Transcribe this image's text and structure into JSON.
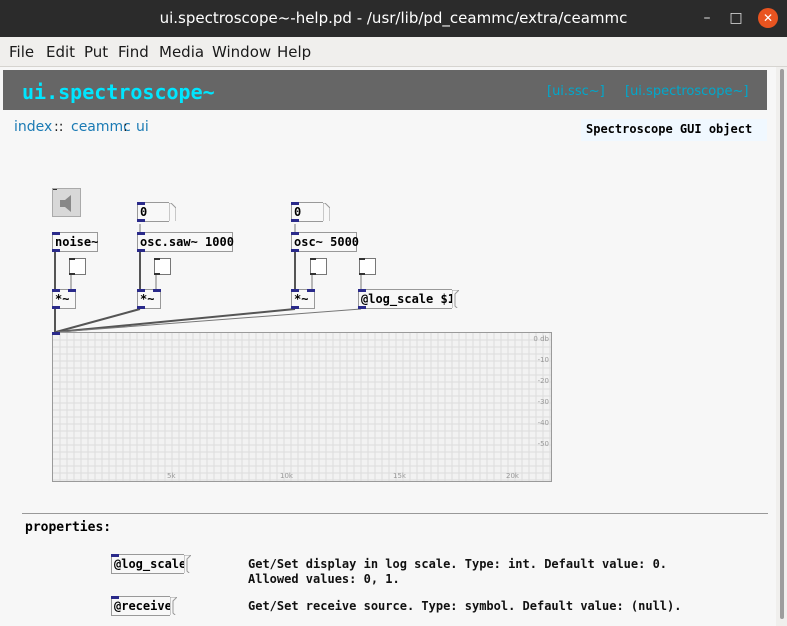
{
  "window": {
    "title": "ui.spectroscope~-help.pd  - /usr/lib/pd_ceammc/extra/ceammc",
    "minimize": "–",
    "maximize": "□",
    "close": "✕"
  },
  "menu": {
    "file": "File",
    "edit": "Edit",
    "put": "Put",
    "find": "Find",
    "media": "Media",
    "window": "Window",
    "help": "Help"
  },
  "header": {
    "title": "ui.spectroscope~",
    "link1": "[ui.ssc~]",
    "link2": "[ui.spectroscope~]",
    "title_color": "#00e6ff",
    "bg_color": "#666666"
  },
  "breadcrumb": {
    "index": "index",
    "sep1": "::",
    "ceammc": "ceammc",
    "sep2": ":",
    "ui": "ui"
  },
  "description": "Spectroscope GUI object",
  "objects": {
    "num1": "0",
    "num2": "0",
    "noise": "noise~",
    "osc_saw": "osc.saw~ 1000",
    "osc": "osc~ 5000",
    "mul1": "*~",
    "mul2": "*~",
    "mul3": "*~",
    "log_scale_msg": "@log_scale $1"
  },
  "spectroscope": {
    "db_labels": [
      "0 db",
      "-10",
      "-20",
      "-30",
      "-40",
      "-50"
    ],
    "freq_labels": [
      "5k",
      "10k",
      "15k",
      "20k"
    ]
  },
  "properties": {
    "title": "properties:",
    "items": [
      {
        "name": "@log_scale",
        "desc1": "Get/Set display in log scale. Type: int. Default value: 0.",
        "desc2": "Allowed values: 0, 1."
      },
      {
        "name": "@receive",
        "desc1": "Get/Set receive source. Type: symbol. Default value: (null)."
      }
    ]
  }
}
